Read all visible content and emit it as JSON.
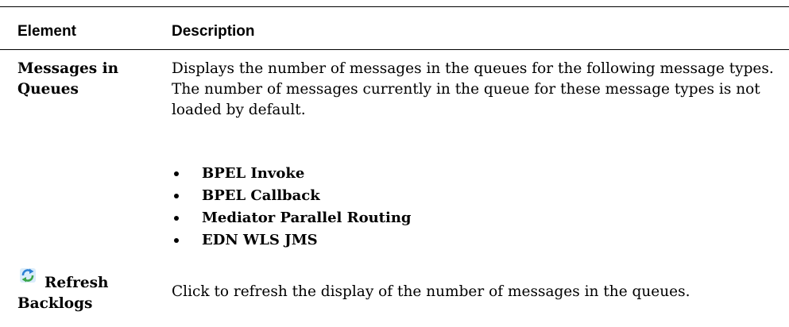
{
  "table": {
    "header": {
      "element": "Element",
      "description": "Description"
    },
    "rows": [
      {
        "element_line1": "Messages in",
        "element_line2": "Queues",
        "description": "Displays the number of messages in the queues for the following message types. The number of messages currently in the queue for these message types is not loaded by default.",
        "bullets": [
          "BPEL Invoke",
          "BPEL Callback",
          "Mediator Parallel Routing",
          "EDN WLS JMS"
        ]
      },
      {
        "icon": "refresh-icon",
        "element_line1": "Refresh",
        "element_line2": "Backlogs",
        "description": "Click to refresh the display of the number of messages in the queues."
      }
    ]
  },
  "colors": {
    "rule": "#000000",
    "icon_blue": "#2a7fd4",
    "icon_green": "#3aa54a"
  }
}
